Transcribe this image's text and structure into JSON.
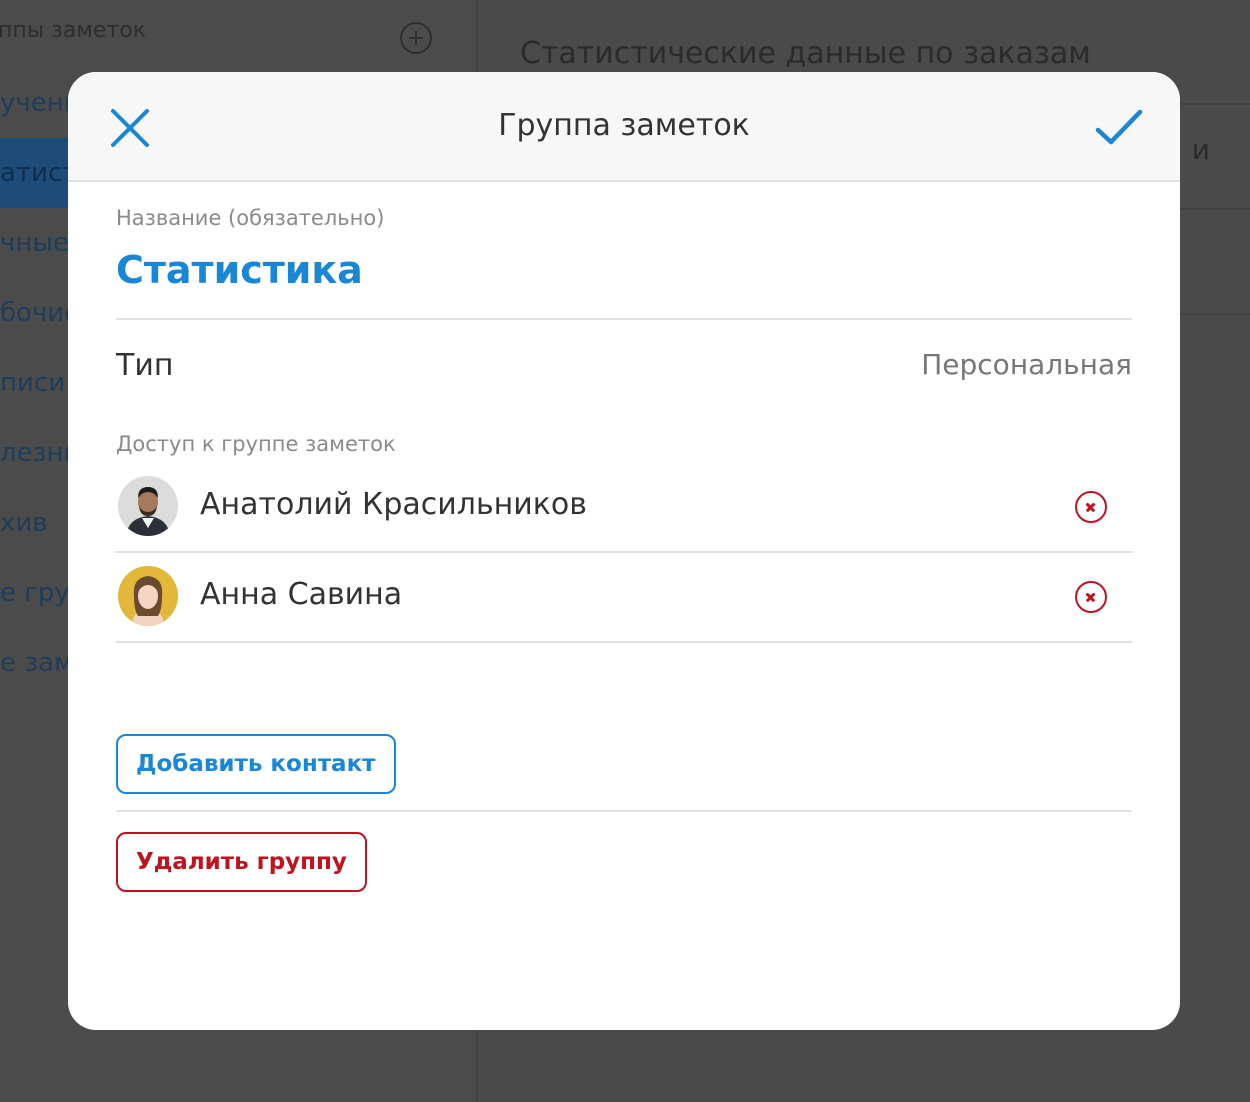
{
  "background": {
    "sidebar": {
      "title": "ппы заметок",
      "items": [
        {
          "label": "учени",
          "active": false
        },
        {
          "label": "атист",
          "active": true
        },
        {
          "label": "чные",
          "active": false
        },
        {
          "label": "бочие",
          "active": false
        },
        {
          "label": "писи с",
          "active": false
        },
        {
          "label": "лезны",
          "active": false
        },
        {
          "label": "хив",
          "active": false
        },
        {
          "label": "е груп",
          "active": false
        },
        {
          "label": "е заме",
          "active": false
        }
      ]
    },
    "main": {
      "title": "Статистические данные по заказам",
      "row_fragment": "и"
    }
  },
  "modal": {
    "title": "Группа заметок",
    "close_icon": "close-icon",
    "confirm_icon": "checkmark-icon",
    "name_label": "Название (обязательно)",
    "name_value": "Статистика",
    "type_label": "Тип",
    "type_value": "Персональная",
    "access_label": "Доступ к группе заметок",
    "contacts": [
      {
        "name": "Анатолий Красильников",
        "avatar": "avatar-man"
      },
      {
        "name": "Анна Савина",
        "avatar": "avatar-woman"
      }
    ],
    "add_contact_label": "Добавить контакт",
    "delete_group_label": "Удалить группу"
  },
  "colors": {
    "accent": "#1a86d6",
    "danger": "#c1121f",
    "overlay": "#4a4a4a"
  }
}
